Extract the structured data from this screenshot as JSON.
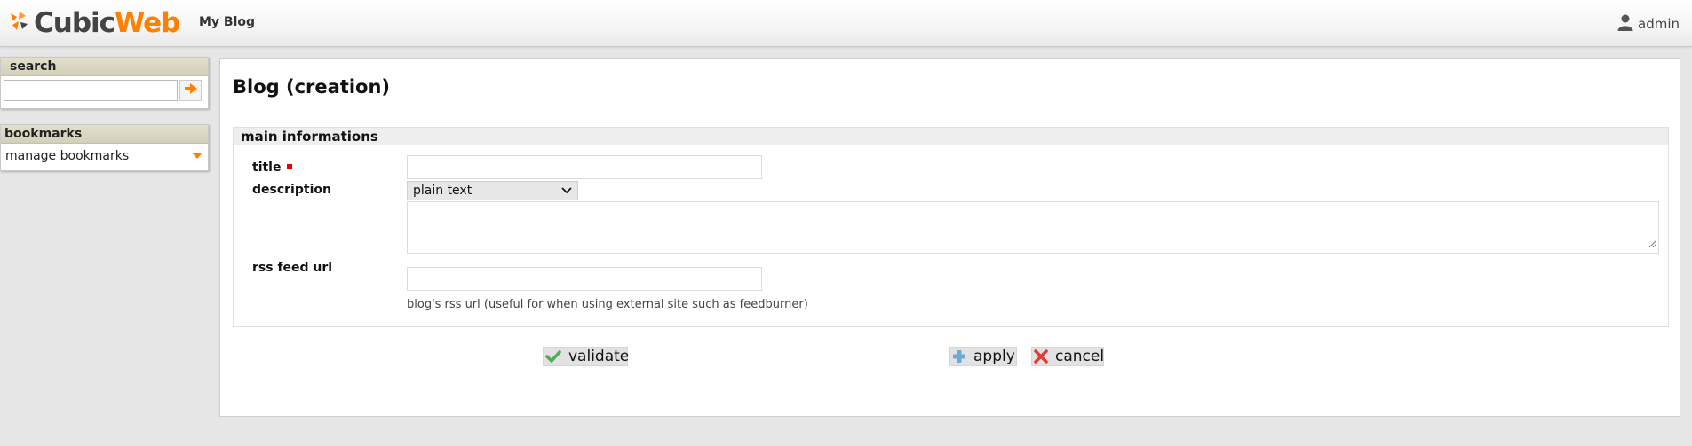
{
  "header": {
    "logo_cubic": "Cubic",
    "logo_web": "Web",
    "site_title": "My Blog",
    "user": "admin"
  },
  "sidebar": {
    "search": {
      "title": "search",
      "value": "",
      "placeholder": ""
    },
    "bookmarks": {
      "title": "bookmarks",
      "manage_label": "manage bookmarks"
    }
  },
  "main": {
    "page_title": "Blog (creation)",
    "section_title": "main informations",
    "fields": {
      "title_label": "title",
      "title_value": "",
      "description_label": "description",
      "description_format": "plain text",
      "description_value": "",
      "rss_label": "rss feed url",
      "rss_value": "",
      "rss_help": "blog's rss url (useful for when using external site such as feedburner)"
    },
    "buttons": {
      "validate": "validate",
      "apply": "apply",
      "cancel": "cancel"
    }
  },
  "colors": {
    "accent": "#ff7f00",
    "required": "#ee0000",
    "sidebar_title_bg": "#d9d7c1",
    "validate_icon": "#4caf50",
    "apply_icon": "#6aa9d8",
    "cancel_icon": "#e53935"
  },
  "icons": {
    "logo": "cubicweb-logo-icon",
    "user": "user-icon",
    "search": "arrow-right-icon",
    "bookmarks": "triangle-down-icon",
    "select": "chevron-down-icon",
    "validate": "check-icon",
    "apply": "plus-icon",
    "cancel": "close-icon"
  }
}
